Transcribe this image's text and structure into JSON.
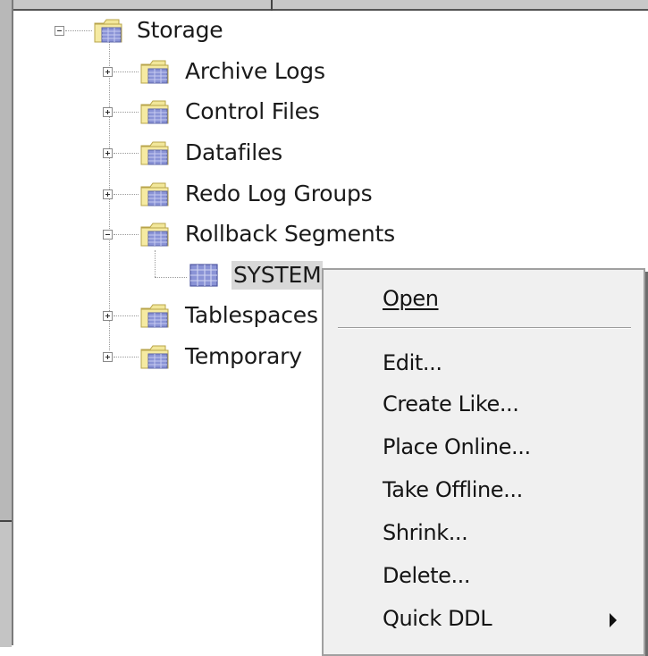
{
  "tree": {
    "root": {
      "label": "Storage",
      "expanded": true
    },
    "children": [
      {
        "label": "Archive Logs",
        "expanded": false
      },
      {
        "label": "Control Files",
        "expanded": false
      },
      {
        "label": "Datafiles",
        "expanded": false
      },
      {
        "label": "Redo Log Groups",
        "expanded": false
      },
      {
        "label": "Rollback Segments",
        "expanded": true
      },
      {
        "label": "Tablespaces",
        "expanded": false
      },
      {
        "label": "Temporary",
        "expanded": false
      }
    ],
    "rollback_child": {
      "label": "SYSTEM",
      "selected": true
    }
  },
  "context_menu": {
    "items": [
      {
        "label": "Open",
        "mnemonic": "O"
      },
      {
        "label": "Edit...",
        "mnemonic": "E"
      },
      {
        "label": "Create Like...",
        "mnemonic": "C"
      },
      {
        "label": "Place Online...",
        "mnemonic": "P"
      },
      {
        "label": "Take Offline...",
        "mnemonic": "T"
      },
      {
        "label": "Shrink...",
        "mnemonic": "S"
      },
      {
        "label": "Delete...",
        "mnemonic": "D"
      },
      {
        "label": "Quick DDL",
        "mnemonic": "Q",
        "has_submenu": true
      }
    ]
  },
  "icons": {
    "folder": "folder-icon",
    "table": "table-icon",
    "expand": "expand-plus-icon",
    "collapse": "collapse-minus-icon",
    "submenu": "submenu-arrow-icon"
  },
  "colors": {
    "folder_tab": "#f2e79a",
    "folder_body": "#8a93d6",
    "selection": "#d8d8d8",
    "menu_bg": "#f0f0f0"
  }
}
